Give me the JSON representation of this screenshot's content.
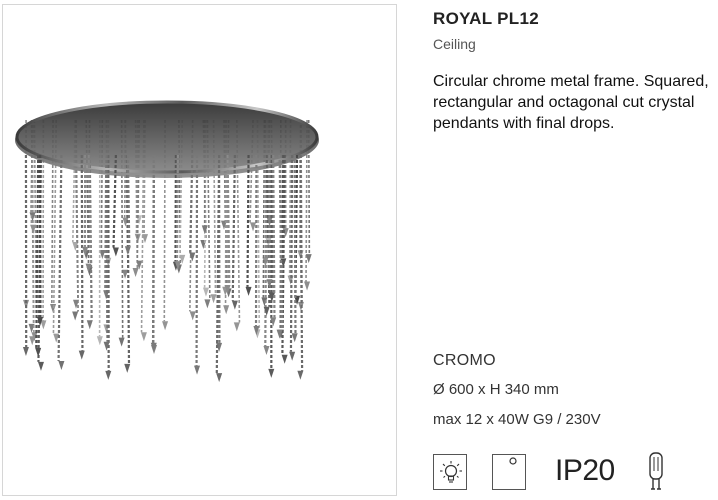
{
  "product": {
    "name": "ROYAL PL12",
    "category": "Ceiling",
    "description": "Circular chrome metal frame. Squared, rectangular and octagonal cut crystal pendants with final drops.",
    "finish": "CROMO",
    "dimensions": "Ø 600 x H 340 mm",
    "power": "max 12 x 40W G9 / 230V"
  },
  "image": {
    "subject": "chandelier-photo"
  },
  "icons": {
    "items": [
      {
        "name": "dimmable-bulb-icon"
      },
      {
        "name": "ceiling-mount-icon"
      },
      {
        "name": "g9-bulb-icon"
      }
    ],
    "ip_rating": "IP20"
  },
  "colors": {
    "frame_border": "#d6d6d6",
    "chrome": "#9a9a9a",
    "crystal": "#6f6f6f",
    "text": "#222222"
  }
}
